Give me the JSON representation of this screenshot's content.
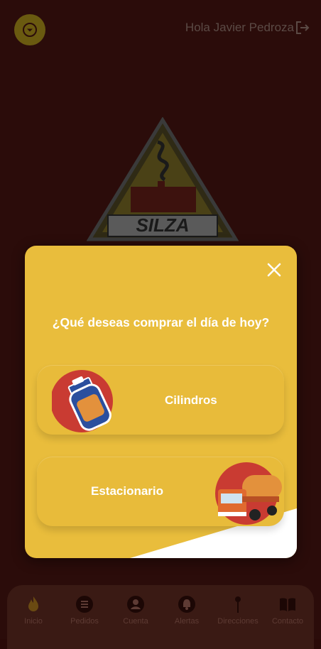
{
  "header": {
    "greeting": "Hola Javier Pedroza",
    "menu_icon": "chevron-down-circle-icon",
    "logout_icon": "logout-icon"
  },
  "logo": {
    "text": "SILZA"
  },
  "modal": {
    "title": "¿Qué deseas comprar el día de hoy?",
    "close_icon": "close-icon",
    "options": [
      {
        "label": "Cilindros",
        "icon": "gas-cylinder-icon"
      },
      {
        "label": "Estacionario",
        "icon": "gas-truck-icon"
      }
    ]
  },
  "nav": {
    "items": [
      {
        "label": "Inicio",
        "icon": "flame-icon"
      },
      {
        "label": "Pedidos",
        "icon": "list-icon"
      },
      {
        "label": "Cuenta",
        "icon": "account-icon"
      },
      {
        "label": "Alertas",
        "icon": "bell-icon"
      },
      {
        "label": "Direcciones",
        "icon": "location-pin-icon"
      },
      {
        "label": "Contacto",
        "icon": "book-icon"
      }
    ]
  },
  "colors": {
    "background": "#2b0c0a",
    "modal": "#e9bd3c",
    "accent_red": "#c93b32",
    "white": "#ffffff"
  }
}
